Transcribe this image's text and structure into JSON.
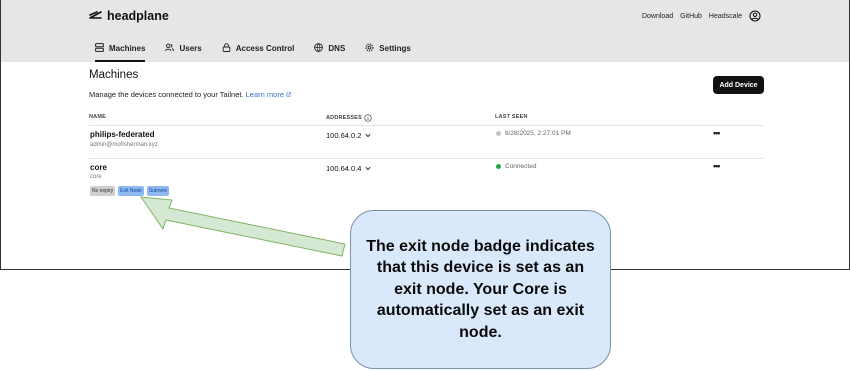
{
  "app": {
    "brand": "headplane",
    "icon": "headplane-logo-icon"
  },
  "top_links": [
    "Download",
    "GitHub",
    "Headscale"
  ],
  "tabs": [
    {
      "label": "Machines",
      "icon": "server-icon",
      "active": true
    },
    {
      "label": "Users",
      "icon": "users-icon",
      "active": false
    },
    {
      "label": "Access Control",
      "icon": "lock-icon",
      "active": false
    },
    {
      "label": "DNS",
      "icon": "globe-icon",
      "active": false
    },
    {
      "label": "Settings",
      "icon": "gear-icon",
      "active": false
    }
  ],
  "page": {
    "title": "Machines",
    "subtitle": "Manage the devices connected to your Tailnet.",
    "learn_more": "Learn more",
    "add_device": "Add Device"
  },
  "table": {
    "headers": {
      "name": "NAME",
      "addresses": "ADDRESSES",
      "last_seen": "LAST SEEN"
    },
    "rows": [
      {
        "name": "philips-federated",
        "user": "admin@mofisherman.xyz",
        "address": "100.64.0.2",
        "last_seen": "8/28/2025, 2:27:01 PM",
        "status_color": "#c4c4c4"
      },
      {
        "name": "core",
        "user": "core",
        "address": "100.64.0.4",
        "last_seen": "Connected",
        "status_color": "#22a744",
        "badges": [
          "No expiry",
          "Exit Node",
          "Subnets"
        ]
      }
    ]
  },
  "callout": {
    "text": "The exit node badge indicates that this device is set as an exit node. Your Core is automatically set as an exit node."
  },
  "colors": {
    "accent_link": "#3b6fd6",
    "callout_fill": "#dae8fb",
    "arrow_fill": "#d5e8d4",
    "arrow_stroke": "#82b366"
  }
}
